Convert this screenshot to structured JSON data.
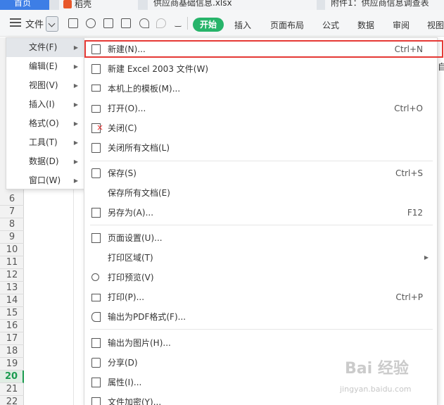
{
  "tabs": [
    {
      "label": "首页"
    },
    {
      "label": "稻壳"
    },
    {
      "label": "供应商基础信息.xlsx"
    },
    {
      "label": "附件1：供应商信息调查表"
    }
  ],
  "toolbar": {
    "file_label": "文件",
    "start_label": "开始",
    "tabs": [
      "插入",
      "页面布局",
      "公式",
      "数据",
      "审阅",
      "视图"
    ]
  },
  "left_menu": {
    "items": [
      {
        "label": "文件(F)"
      },
      {
        "label": "编辑(E)"
      },
      {
        "label": "视图(V)"
      },
      {
        "label": "插入(I)"
      },
      {
        "label": "格式(O)"
      },
      {
        "label": "工具(T)"
      },
      {
        "label": "数据(D)"
      },
      {
        "label": "窗口(W)"
      }
    ]
  },
  "file_menu": {
    "items": [
      {
        "label": "新建(N)...",
        "shortcut": "Ctrl+N"
      },
      {
        "label": "新建 Excel 2003 文件(W)",
        "shortcut": ""
      },
      {
        "label": "本机上的模板(M)...",
        "shortcut": ""
      },
      {
        "label": "打开(O)...",
        "shortcut": "Ctrl+O"
      },
      {
        "label": "关闭(C)",
        "shortcut": ""
      },
      {
        "label": "关闭所有文档(L)",
        "shortcut": ""
      },
      {
        "label": "保存(S)",
        "shortcut": "Ctrl+S"
      },
      {
        "label": "保存所有文档(E)",
        "shortcut": ""
      },
      {
        "label": "另存为(A)...",
        "shortcut": "F12"
      },
      {
        "label": "页面设置(U)...",
        "shortcut": ""
      },
      {
        "label": "打印区域(T)",
        "shortcut": ""
      },
      {
        "label": "打印预览(V)",
        "shortcut": ""
      },
      {
        "label": "打印(P)...",
        "shortcut": "Ctrl+P"
      },
      {
        "label": "输出为PDF格式(F)...",
        "shortcut": ""
      },
      {
        "label": "输出为图片(H)...",
        "shortcut": ""
      },
      {
        "label": "分享(D)",
        "shortcut": ""
      },
      {
        "label": "属性(I)...",
        "shortcut": ""
      },
      {
        "label": "文件加密(Y)...",
        "shortcut": ""
      }
    ]
  },
  "row_numbers": [
    "6",
    "7",
    "8",
    "9",
    "10",
    "11",
    "12",
    "13",
    "14",
    "15",
    "16",
    "17",
    "18",
    "19",
    "20",
    "21",
    "22"
  ],
  "active_row": "20",
  "right_cut_text": "自",
  "watermark": {
    "main": "Bai 经验",
    "sub": "jingyan.baidu.com"
  },
  "colors": {
    "accent": "#27b46a",
    "highlight_border": "#e53935",
    "home_tab": "#3d7ee6"
  }
}
